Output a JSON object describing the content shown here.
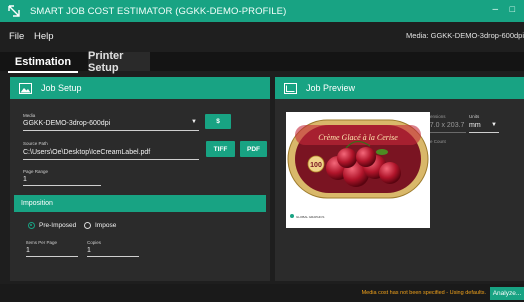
{
  "window": {
    "title": "SMART JOB COST ESTIMATOR (GGKK-DEMO-PROFILE)",
    "minimize": "–",
    "maximize": "□"
  },
  "menu": {
    "file": "File",
    "help": "Help",
    "media_status": "Media: GGKK-DEMO-3drop-600dpi"
  },
  "tabs": {
    "estimation": "Estimation",
    "printer_setup": "Printer Setup"
  },
  "job_setup": {
    "header": "Job Setup",
    "media_label": "Media",
    "media_value": "GGKK-DEMO-3drop-600dpi",
    "dollar_button": "$",
    "source_label": "Source Path",
    "source_value": "C:\\Users\\Oe\\Desktop\\IceCreamLabel.pdf",
    "tiff_button": "TIFF",
    "pdf_button": "PDF",
    "page_range_label": "Page Range",
    "page_range_value": "1",
    "imposition_title": "Imposition",
    "pre_imposed_label": "Pre-Imposed",
    "impose_label": "Impose",
    "items_per_page_label": "Items Per Page",
    "items_per_page_value": "1",
    "copies_label": "Copies",
    "copies_value": "1"
  },
  "job_preview": {
    "header": "Job Preview",
    "dimensions_label": "Dimensions",
    "dimensions_value": "297.0 x 203.7",
    "units_label": "Units",
    "units_value": "mm",
    "page_count_label": "Page Count",
    "page_count_value": "1",
    "label_title": "Crème Glacé à la Cerise",
    "label_badge": "100",
    "label_brand": "GLOBAL GRAPHICS"
  },
  "status": {
    "message": "Media cost has not been specified - Using defaults.",
    "analyze_button": "Analyze..."
  },
  "colors": {
    "accent": "#18a383",
    "background": "#1e1e1e",
    "panel": "#2b2b2b",
    "warning": "#f0a11a"
  }
}
